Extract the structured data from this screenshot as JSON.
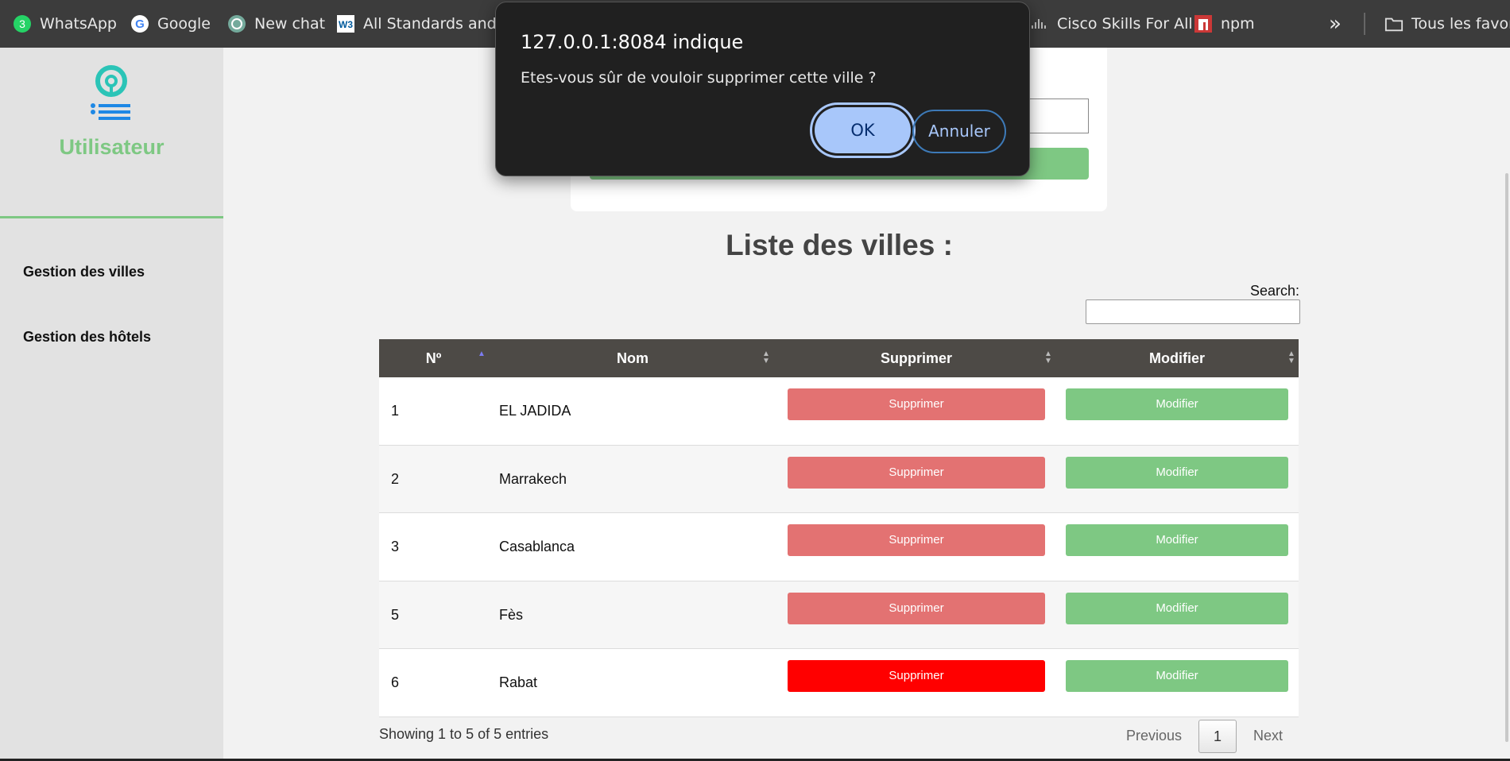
{
  "bookmarks": [
    {
      "label": "WhatsApp",
      "icon": "whatsapp-icon",
      "badge": "3"
    },
    {
      "label": "Google",
      "icon": "google-icon"
    },
    {
      "label": "New chat",
      "icon": "chatgpt-icon"
    },
    {
      "label": "All Standards and D...",
      "icon": "w3c-icon"
    },
    {
      "label": "Cisco Skills For All",
      "icon": "cisco-icon"
    },
    {
      "label": "npm",
      "icon": "npm-icon"
    }
  ],
  "bookmarks_more_glyph": "»",
  "bookmarks_folder": "Tous les favoris",
  "sidebar": {
    "title": "Utilisateur",
    "items": [
      {
        "label": "Gestion des villes"
      },
      {
        "label": "Gestion des hôtels"
      }
    ]
  },
  "main": {
    "list_title": "Liste des villes :",
    "search_label": "Search:",
    "search_value": "",
    "columns": [
      "Nº",
      "Nom",
      "Supprimer",
      "Modifier"
    ],
    "rows": [
      {
        "num": "1",
        "nom": "EL JADIDA",
        "delete_label": "Supprimer",
        "edit_label": "Modifier"
      },
      {
        "num": "2",
        "nom": "Marrakech",
        "delete_label": "Supprimer",
        "edit_label": "Modifier"
      },
      {
        "num": "3",
        "nom": "Casablanca",
        "delete_label": "Supprimer",
        "edit_label": "Modifier"
      },
      {
        "num": "5",
        "nom": "Fès",
        "delete_label": "Supprimer",
        "edit_label": "Modifier"
      },
      {
        "num": "6",
        "nom": "Rabat",
        "delete_label": "Supprimer",
        "edit_label": "Modifier"
      }
    ],
    "showing": "Showing 1 to 5 of 5 entries",
    "pagination": {
      "previous": "Previous",
      "page": "1",
      "next": "Next"
    }
  },
  "dialog": {
    "title": "127.0.0.1:8084 indique",
    "message": "Etes-vous sûr de vouloir supprimer cette ville ?",
    "ok_label": "OK",
    "cancel_label": "Annuler"
  },
  "colors": {
    "accent_green": "#7ec883",
    "delete_red": "#e37272",
    "delete_red_hover": "#ff0000",
    "table_header": "#4d4a46",
    "dialog_bg": "#202020",
    "dialog_button": "#a8c7fa"
  }
}
